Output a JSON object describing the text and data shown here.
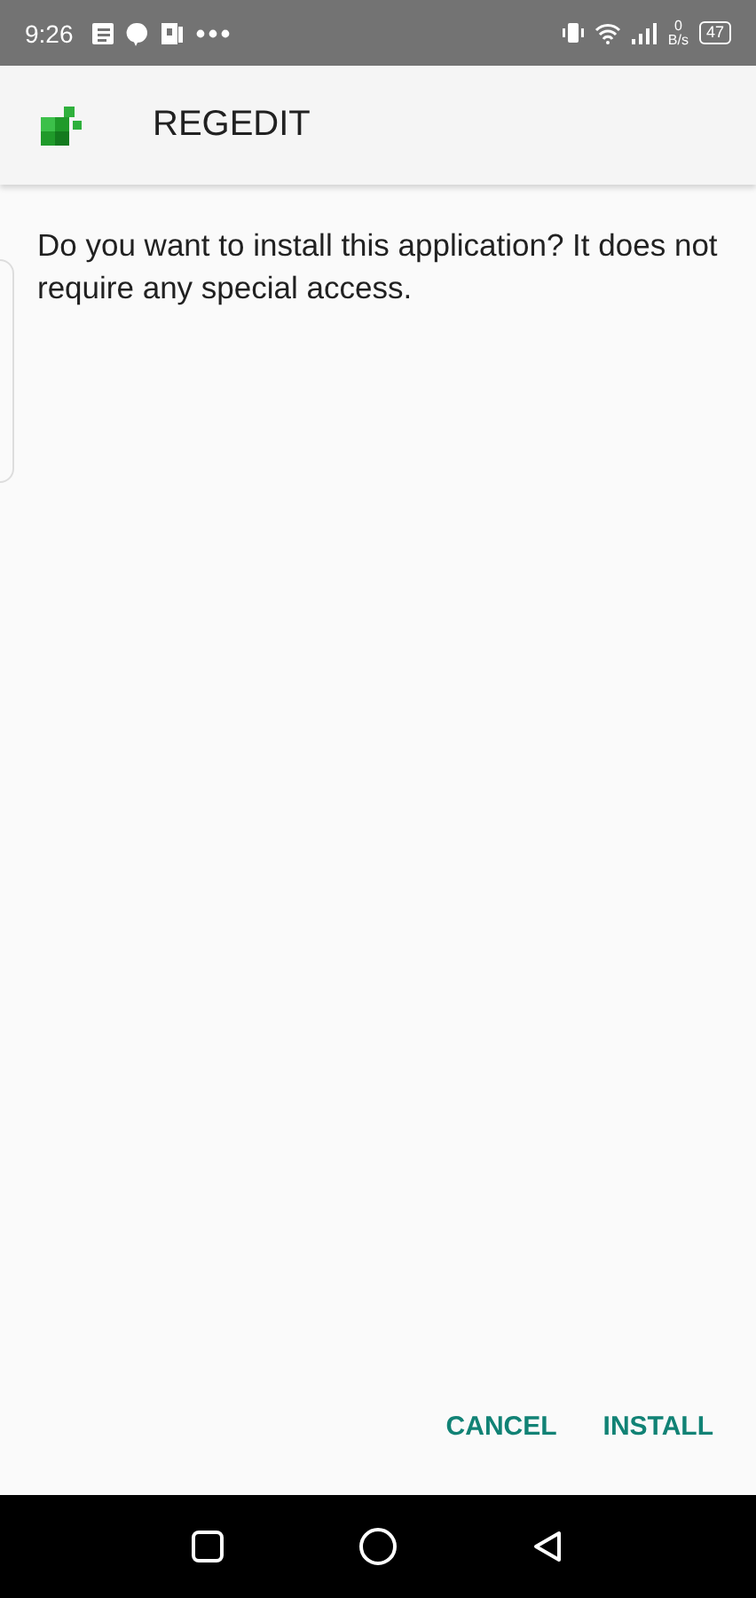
{
  "status_bar": {
    "time": "9:26",
    "net_speed_value": "0",
    "net_speed_unit": "B/s",
    "battery": "47"
  },
  "app_bar": {
    "title": "REGEDIT"
  },
  "message": "Do you want to install this application? It does not require any special access.",
  "buttons": [
    {
      "label": "CANCEL"
    },
    {
      "label": "INSTALL"
    }
  ]
}
